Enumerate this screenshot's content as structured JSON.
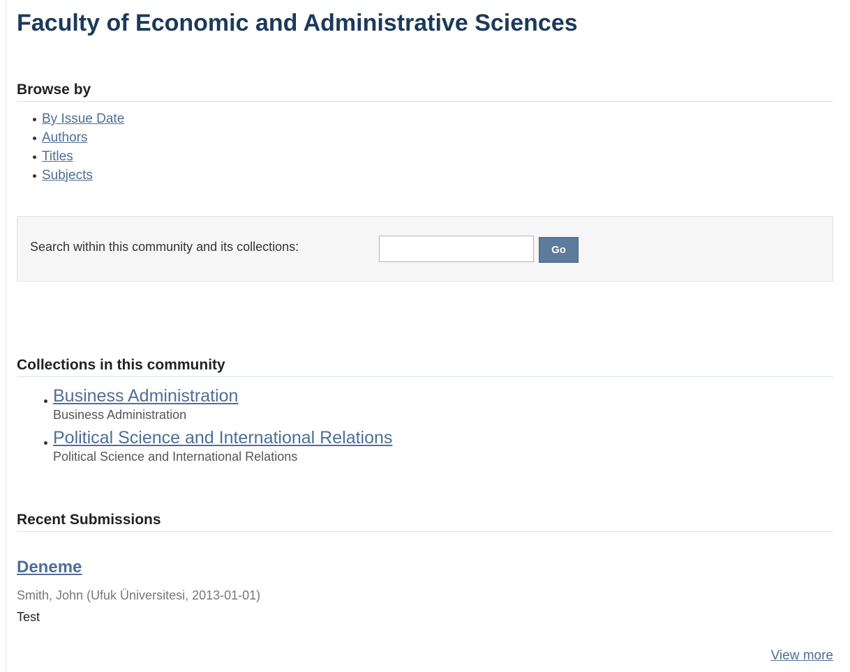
{
  "page_title": "Faculty of Economic and Administrative Sciences",
  "browse": {
    "heading": "Browse by",
    "items": [
      {
        "label": "By Issue Date"
      },
      {
        "label": "Authors"
      },
      {
        "label": "Titles"
      },
      {
        "label": "Subjects"
      }
    ]
  },
  "search": {
    "label": "Search within this community and its collections:",
    "value": "",
    "button_label": "Go"
  },
  "collections": {
    "heading": "Collections in this community",
    "items": [
      {
        "title": "Business Administration",
        "description": "Business Administration"
      },
      {
        "title": "Political Science and International Relations",
        "description": "Political Science and International Relations"
      }
    ]
  },
  "recent": {
    "heading": "Recent Submissions",
    "items": [
      {
        "title": "Deneme",
        "meta": "Smith, John (Ufuk Üniversitesi, 2013-01-01)",
        "abstract": "Test"
      }
    ],
    "view_more": "View more"
  },
  "colors": {
    "title": "#1c3a5a",
    "link": "#4f6e96",
    "button": "#5d7b9a"
  }
}
